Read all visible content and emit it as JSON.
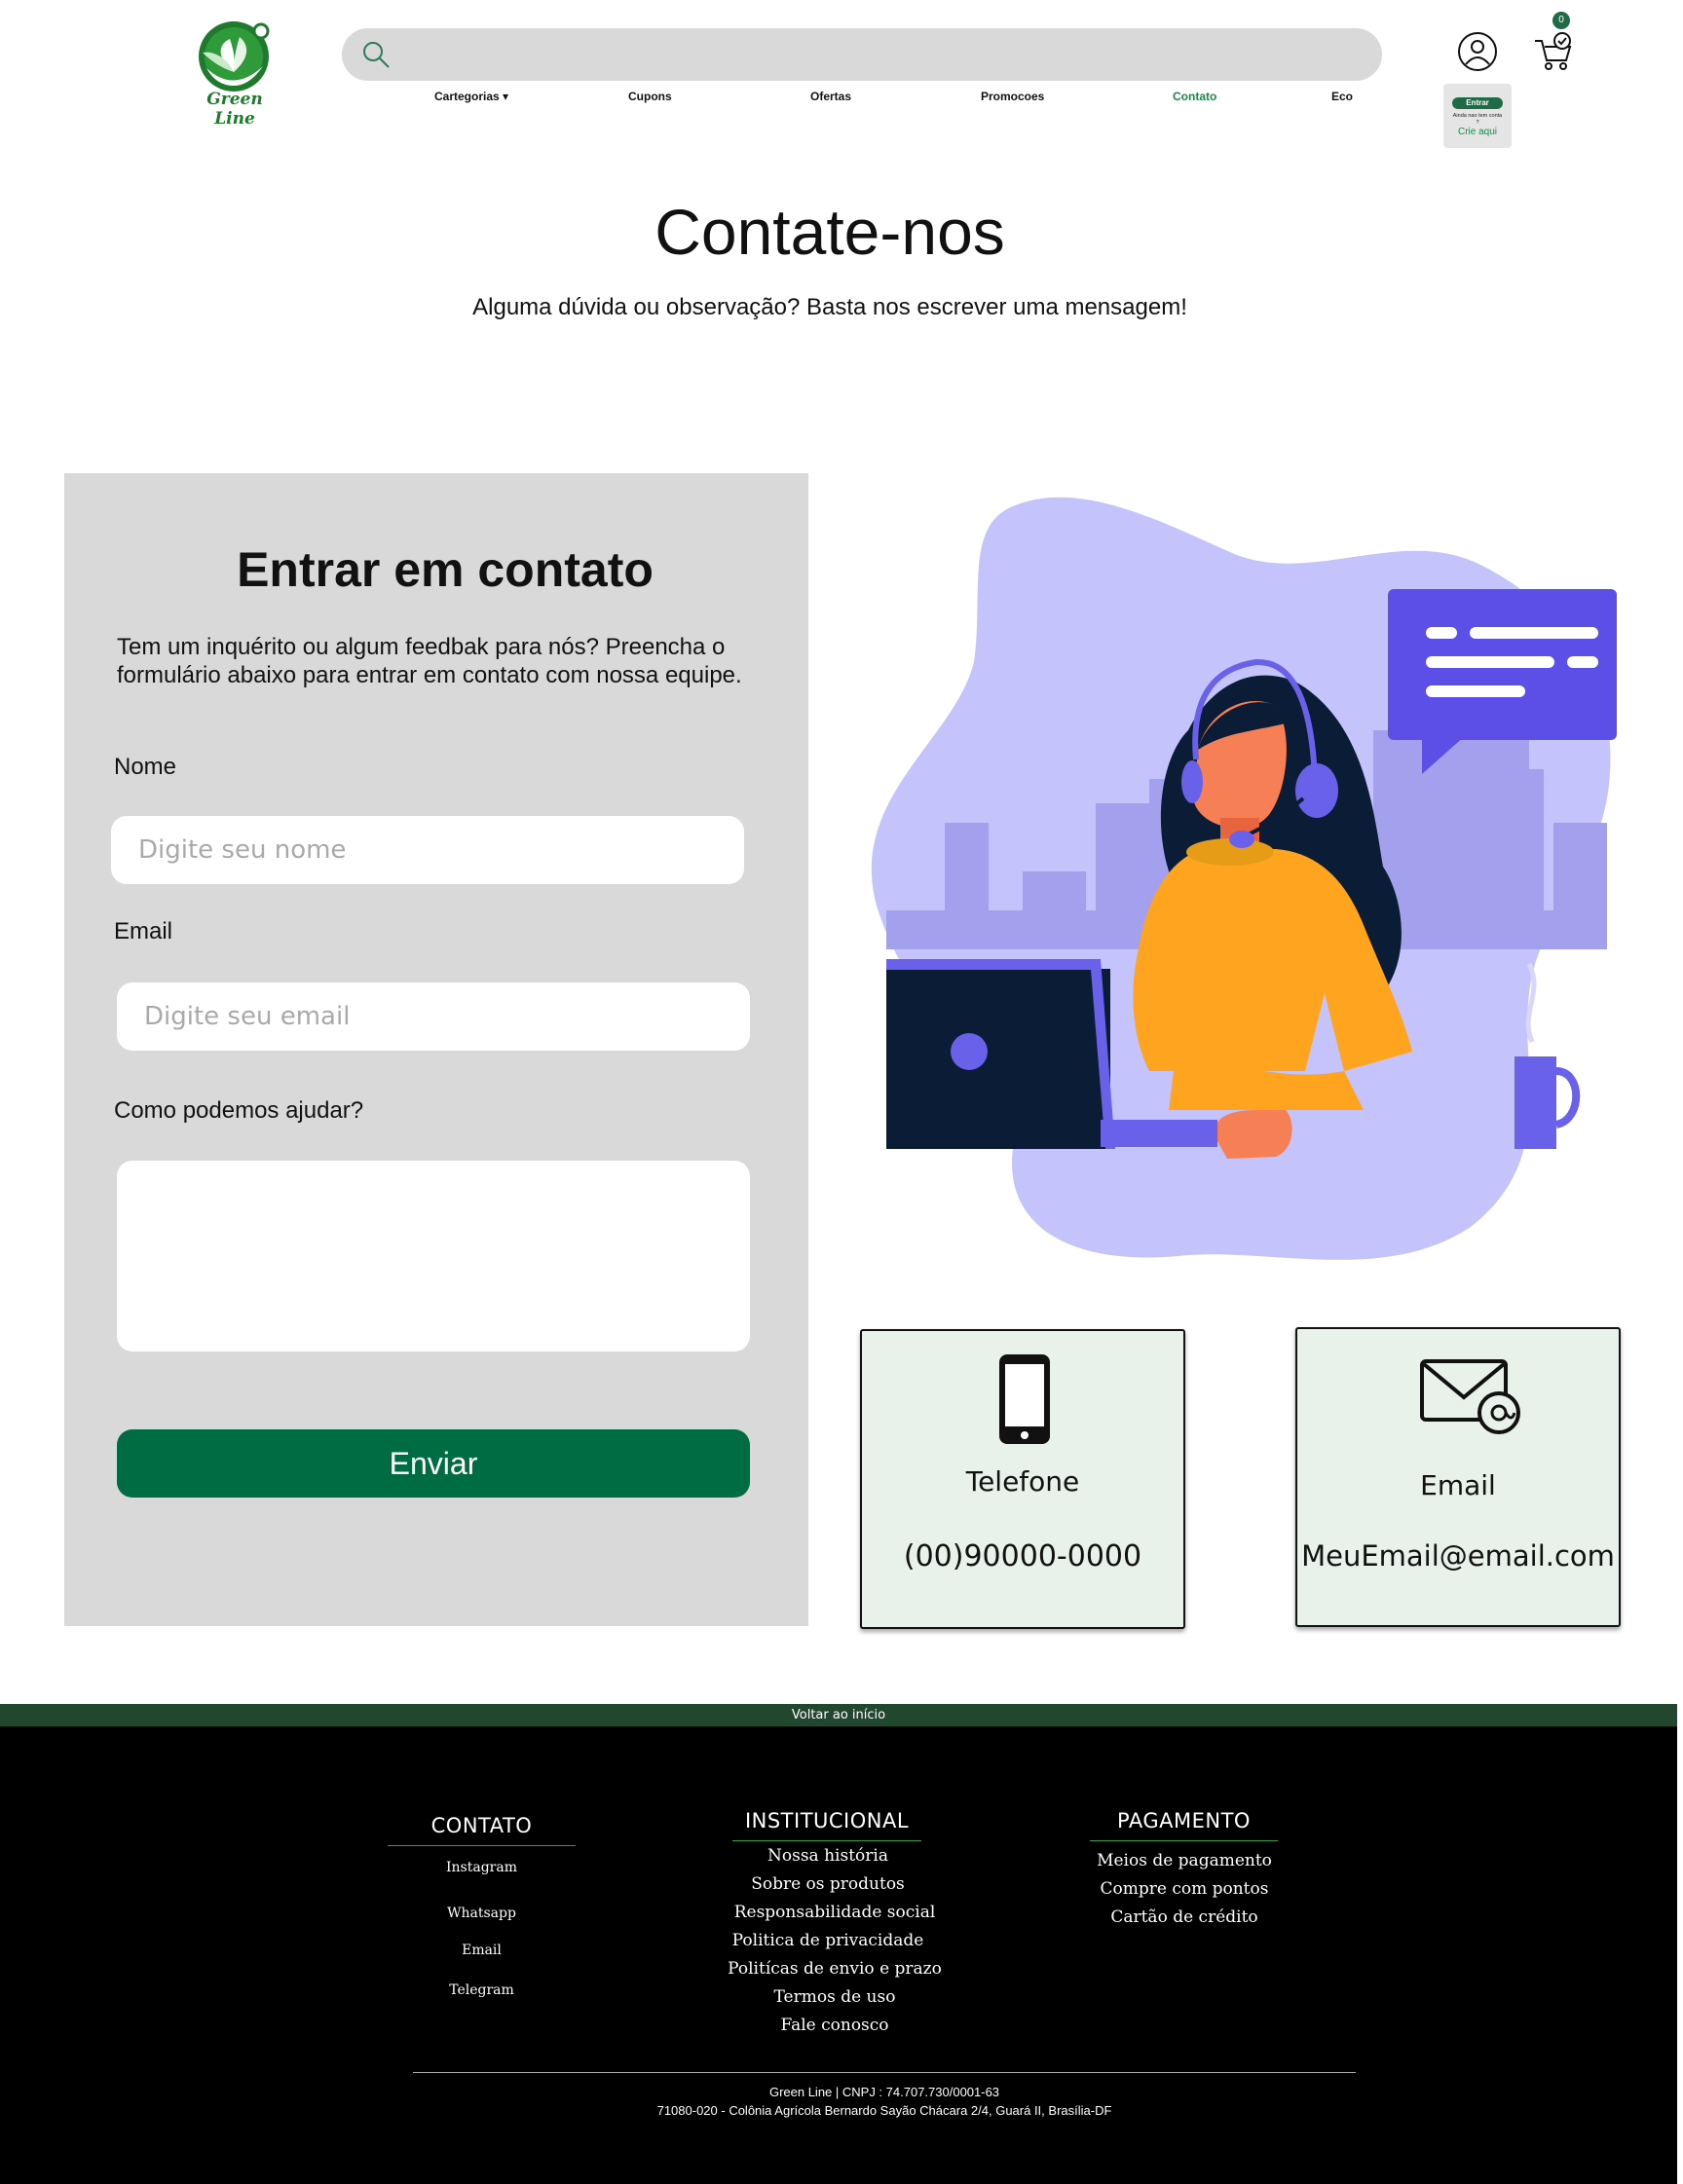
{
  "header": {
    "logo_text": "Green Line",
    "search_placeholder": "",
    "nav": [
      {
        "label": "Cartegorias ▾"
      },
      {
        "label": "Cupons"
      },
      {
        "label": "Ofertas"
      },
      {
        "label": "Promocoes"
      },
      {
        "label": "Contato",
        "active": true
      },
      {
        "label": "Eco"
      }
    ],
    "cart_count": "0",
    "login": {
      "button": "Entrar",
      "note": "Ainda nao tem conta ?",
      "link": "Crie aqui"
    }
  },
  "hero": {
    "title": "Contate-nos",
    "subtitle": "Alguma dúvida ou  observação? Basta nos escrever  uma mensagem!"
  },
  "form": {
    "title": "Entrar em contato",
    "description": "Tem um inquérito ou algum feedbak para nós? Preencha o formulário abaixo para entrar em contato com nossa equipe.",
    "name_label": "Nome",
    "name_placeholder": "Digite seu nome",
    "email_label": "Email",
    "email_placeholder": "Digite seu email",
    "help_label": "Como podemos ajudar?",
    "help_value": "",
    "submit": "Enviar"
  },
  "cards": {
    "phone": {
      "title": "Telefone",
      "value": "(00)90000-0000",
      "icon": "phone-icon"
    },
    "email": {
      "title": "Email",
      "value": "MeuEmail@email.com",
      "icon": "mail-at-icon"
    }
  },
  "footer": {
    "back_to_top": "Voltar ao início",
    "contato": {
      "title": "CONTATO",
      "items": [
        "Instagram",
        "Whatsapp",
        "Email",
        "Telegram"
      ]
    },
    "institucional": {
      "title": "INSTITUCIONAL",
      "items": [
        "Nossa história",
        "Sobre os produtos",
        "Responsabilidade social",
        "Politica de privacidade",
        "Politícas de envio e prazo",
        "Termos de uso",
        "Fale conosco"
      ]
    },
    "pagamento": {
      "title": "PAGAMENTO",
      "items": [
        "Meios de pagamento",
        "Compre com pontos",
        "Cartão de crédito"
      ]
    },
    "copyright": "Green Line | CNPJ : 74.707.730/0001-63",
    "address": "71080-020 - Colônia Agrícola Bernardo Sayão Chácara 2/4, Guará II, Brasília-DF"
  },
  "colors": {
    "brand_green": "#006c44",
    "footer_bar": "#22472f",
    "card_bg": "#e8f1ea",
    "panel_bg": "#d9d9d9",
    "illustration_purple": "#c4c3fb"
  }
}
